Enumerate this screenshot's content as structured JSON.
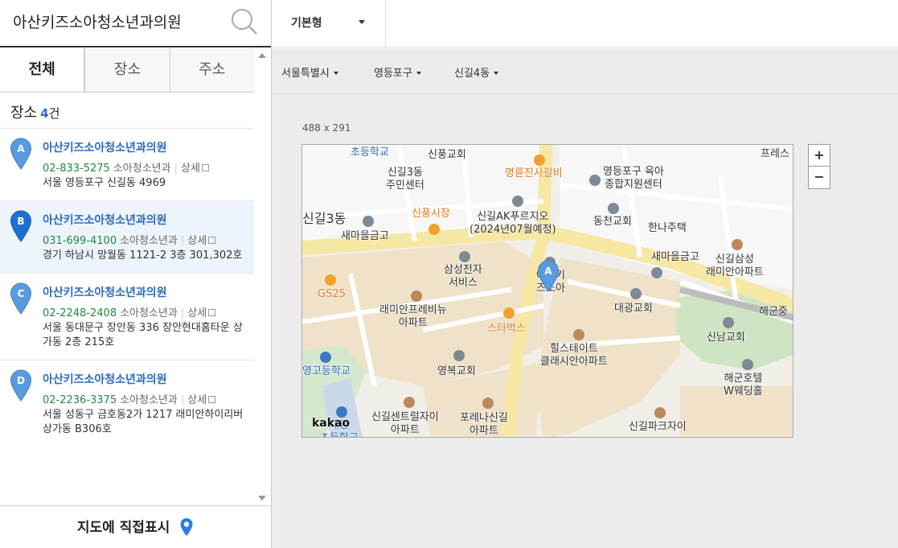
{
  "search": {
    "query": "아산키즈소아청소년과의원"
  },
  "tabs": [
    "전체",
    "장소",
    "주소"
  ],
  "results_header": {
    "label": "장소",
    "count": "4",
    "unit": "건"
  },
  "results": [
    {
      "marker": "A",
      "name": "아산키즈소아청소년과의원",
      "phone": "02-833-5275",
      "category": "소아청소년과",
      "detail": "상세",
      "address": "서울 영등포구 신길동 4969"
    },
    {
      "marker": "B",
      "name": "아산키즈소아청소년과의원",
      "phone": "031-699-4100",
      "category": "소아청소년과",
      "detail": "상세",
      "address": "경기 하남시 망월동 1121-2 3층 301,302호"
    },
    {
      "marker": "C",
      "name": "아산키즈소아청소년과의원",
      "phone": "02-2248-2408",
      "category": "소아청소년과",
      "detail": "상세",
      "address": "서울 동대문구 장안동 336 장안현대홈타운 상가동 2층 215호"
    },
    {
      "marker": "D",
      "name": "아산키즈소아청소년과의원",
      "phone": "02-2236-3375",
      "category": "소아청소년과",
      "detail": "상세",
      "address": "서울 성동구 금호동2가 1217 래미안하이리버 상가동 B306호"
    }
  ],
  "bottom_action": "지도에 직접표시",
  "map_style": "기본형",
  "breadcrumbs": [
    "서울특별시",
    "영등포구",
    "신길4동"
  ],
  "map_size": "488 x 291",
  "map": {
    "marker": "A",
    "attribution": "kakao",
    "labels": {
      "school1": "초등학교",
      "church1": "신풍교회",
      "center": "신길3동\n주민센터",
      "restaurant": "명륜진사갈비",
      "welfare": "영등포구 육아\n종합지원센터",
      "press": "프레스",
      "dong": "신길3동",
      "market": "신풍시장",
      "ak": "신길AK푸르지오\n(2024년07월예정)",
      "church2": "동천교회",
      "hanna": "한나주택",
      "bank1": "새마을금고",
      "samsung": "삼성전자\n서비스",
      "clinic": "아산키즈소아청소년과의원",
      "bank2": "새마을금고",
      "apt1": "신길삼성\n래미안아파트",
      "gs25": "GS25",
      "apt2": "래미안프레비뉴\n아파트",
      "church3": "대광교회",
      "navy": "해군중",
      "starbucks": "스타벅스",
      "apt3": "힐스테이트\n클래시안아파트",
      "church4": "신남교회",
      "school2": "영고등학교",
      "church5": "영복교회",
      "hotel": "해군호텔\nW웨딩홀",
      "apt4": "신길센트럴자이\n아파트",
      "apt5": "포레나신길\n아파트",
      "apt6": "신길파크자이",
      "school3": "대영\n초등학교"
    }
  },
  "zoom": {
    "in": "+",
    "out": "−"
  },
  "colors": {
    "accent": "#2b6bbd",
    "phone": "#1d8a42",
    "marker": "#4a8fd9"
  }
}
